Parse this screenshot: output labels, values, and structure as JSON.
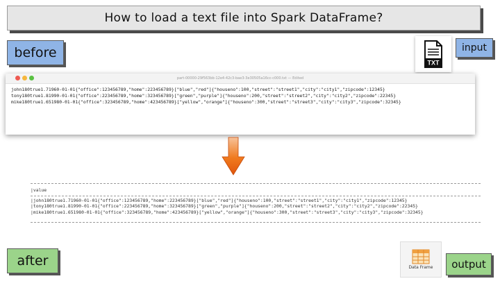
{
  "title": "How to load a text file into Spark DataFrame?",
  "labels": {
    "before": "before",
    "input": "input",
    "after": "after",
    "output": "output"
  },
  "icons": {
    "input": "txt-file-icon",
    "output": "spark-dataframe-icon",
    "arrow": "down-arrow-icon"
  },
  "input_icon_text": "TXT",
  "output_icon_text": "Data Frame",
  "editor": {
    "filename": "part-00000-29f563bb-12e4-42c3-bae3-3e30505a16cc-c000.txt — Edited",
    "lines": [
      "john180true1.71960-01-01{\"office\":123456789,\"home\":223456789}[\"blue\",\"red\"]{\"houseno\":100,\"street\":\"street1\",\"city\":\"city1\",\"zipcode\":12345}",
      "tony180true1.81990-01-01{\"office\":223456789,\"home\":323456789}[\"green\",\"purple\"]{\"houseno\":200,\"street\":\"street2\",\"city\":\"city2\",\"zipcode\":22345}",
      "mike180true1.651980-01-01{\"office\":323456789,\"home\":423456789}[\"yellow\",\"orange\"]{\"houseno\":300,\"street\":\"street3\",\"city\":\"city3\",\"zipcode\":32345}"
    ]
  },
  "result": {
    "column": "|value",
    "rows": [
      "|john180true1.71960-01-01{\"office\":123456789,\"home\":223456789}[\"blue\",\"red\"]{\"houseno\":100,\"street\":\"street1\",\"city\":\"city1\",\"zipcode\":12345}",
      "|tony180true1.81990-01-01{\"office\":223456789,\"home\":323456789}[\"green\",\"purple\"]{\"houseno\":200,\"street\":\"street2\",\"city\":\"city2\",\"zipcode\":22345}",
      "|mike180true1.651980-01-01{\"office\":323456789,\"home\":423456789}[\"yellow\",\"orange\"]{\"houseno\":300,\"street\":\"street3\",\"city\":\"city3\",\"zipcode\":32345}"
    ]
  },
  "colors": {
    "tag_blue": "#8fb4e6",
    "tag_green": "#9bd48a",
    "arrow": "#f07a1e"
  }
}
